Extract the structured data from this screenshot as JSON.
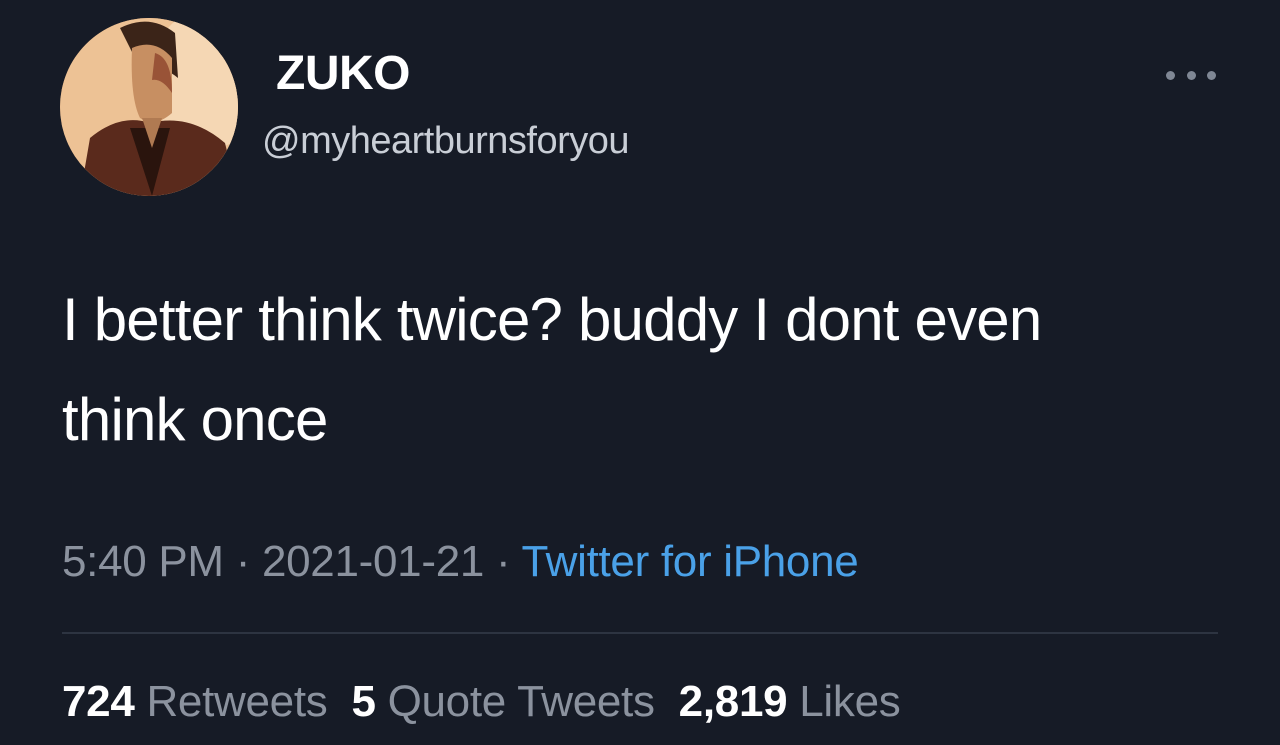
{
  "tweet": {
    "display_name": "ZUKO",
    "handle": "@myheartburnsforyou",
    "text_line1": "I better think twice? buddy I dont even",
    "text_line2": "think once",
    "time": "5:40 PM",
    "separator": " · ",
    "date": "2021-01-21",
    "source": "Twitter for iPhone",
    "avatar_icon": "profile-avatar",
    "more_icon": "more-horizontal-icon"
  },
  "stats": {
    "retweets_count": "724",
    "retweets_label": "Retweets",
    "quotes_count": "5",
    "quotes_label": "Quote Tweets",
    "likes_count": "2,819",
    "likes_label": "Likes"
  },
  "colors": {
    "background": "#161b26",
    "accent": "#4aa1e8",
    "muted": "#8b929e"
  }
}
